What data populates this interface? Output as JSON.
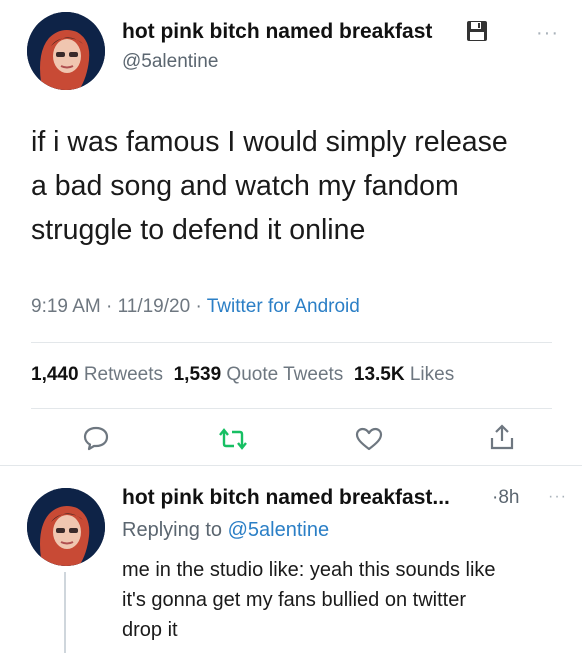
{
  "main_tweet": {
    "display_name": "hot pink bitch named breakfast",
    "name_icon": "floppy-disk-icon",
    "handle": "@5alentine",
    "more_icon": "more-dots-icon",
    "text_lines": [
      "if i was famous I would simply release",
      "a bad song and watch my fandom",
      "struggle to defend it online"
    ],
    "time": "9:19 AM",
    "date": "11/19/20",
    "source": "Twitter for Android",
    "sep": "·",
    "stats": {
      "retweets_count": "1,440",
      "retweets_label": "Retweets",
      "quotes_count": "1,539",
      "quotes_label": "Quote Tweets",
      "likes_count": "13.5K",
      "likes_label": "Likes"
    },
    "actions": [
      "reply-icon",
      "retweet-icon",
      "like-icon",
      "share-icon"
    ]
  },
  "reply_tweet": {
    "display_name": "hot pink bitch named breakfast...",
    "time_ago": "8h",
    "sep": "·",
    "replying_prefix": "Replying to",
    "replying_handle": "@5alentine",
    "text_lines": [
      "me in the studio like: yeah this sounds like",
      "it's gonna get my fans bullied on twitter",
      "drop it"
    ]
  },
  "colors": {
    "link": "#2b7fc6",
    "retweet_green": "#17bf63",
    "muted": "#6e7780"
  }
}
